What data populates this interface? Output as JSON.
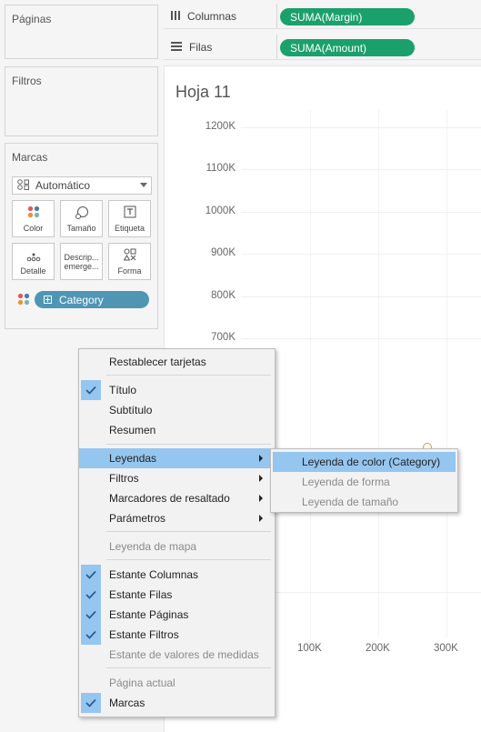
{
  "cards": {
    "paginas": "Páginas",
    "filtros": "Filtros",
    "marcas": "Marcas"
  },
  "marks": {
    "type": "Automático",
    "buttons": {
      "color": "Color",
      "size": "Tamaño",
      "label": "Etiqueta",
      "detail": "Detalle",
      "tooltip_line1": "Descrip...",
      "tooltip_line2": "emerge...",
      "shape": "Forma"
    },
    "field_pill": "Category"
  },
  "shelves": {
    "columns_label": "Columnas",
    "columns_pill": "SUMA(Margin)",
    "rows_label": "Filas",
    "rows_pill": "SUMA(Amount)"
  },
  "sheet": {
    "title": "Hoja 11",
    "y_ticks": [
      "1200K",
      "1100K",
      "1000K",
      "900K",
      "800K",
      "700K"
    ],
    "x_ticks": [
      "100K",
      "200K",
      "300K"
    ],
    "point_color": "#f28e2b"
  },
  "menu": {
    "reset": "Restablecer tarjetas",
    "title": "Título",
    "subtitle": "Subtítulo",
    "summary": "Resumen",
    "legends": "Leyendas",
    "filters": "Filtros",
    "highlighters": "Marcadores de resaltado",
    "parameters": "Parámetros",
    "map_legend": "Leyenda de mapa",
    "columns_shelf": "Estante Columnas",
    "rows_shelf": "Estante Filas",
    "pages_shelf": "Estante Páginas",
    "filters_shelf": "Estante Filtros",
    "measure_values_shelf": "Estante de valores de medidas",
    "current_page": "Página actual",
    "marks": "Marcas"
  },
  "submenu": {
    "color_legend": "Leyenda de color (Category)",
    "shape_legend": "Leyenda de forma",
    "size_legend": "Leyenda de tamaño"
  }
}
